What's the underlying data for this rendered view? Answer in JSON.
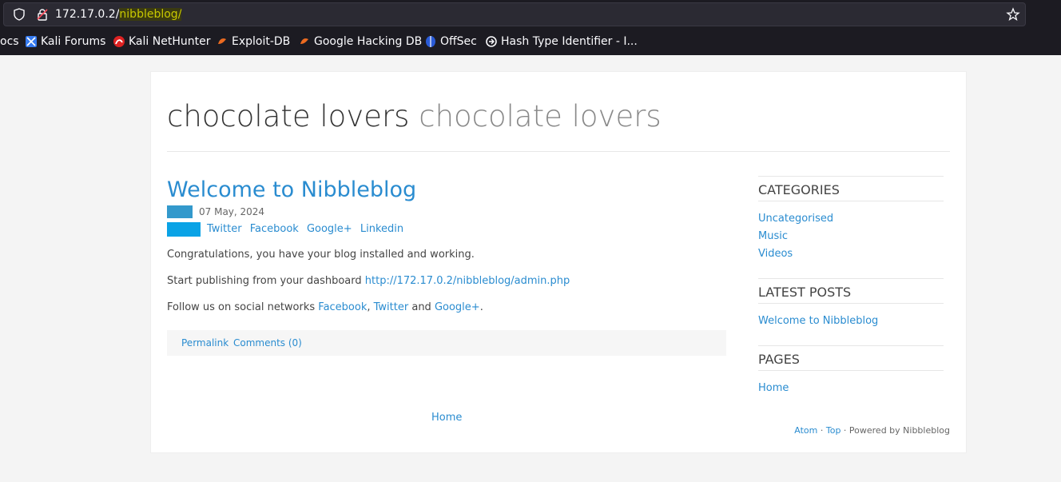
{
  "browser": {
    "url_host": "172.17.0.2/",
    "url_path": "nibbleblog/",
    "bookmarks": [
      {
        "label": "ocs",
        "icon": "none"
      },
      {
        "label": "Kali Forums",
        "icon": "kali-forums-icon"
      },
      {
        "label": "Kali NetHunter",
        "icon": "nethunter-icon"
      },
      {
        "label": "Exploit-DB",
        "icon": "exploit-db-icon"
      },
      {
        "label": "Google Hacking DB",
        "icon": "ghdb-icon"
      },
      {
        "label": "OffSec",
        "icon": "offsec-icon"
      },
      {
        "label": "Hash Type Identifier - I...",
        "icon": "hash-icon"
      }
    ]
  },
  "site": {
    "name": "chocolate lovers",
    "slogan": "chocolate lovers"
  },
  "post": {
    "title": "Welcome to Nibbleblog",
    "date": "07 May, 2024",
    "share": [
      "Twitter",
      "Facebook",
      "Google+",
      "Linkedin"
    ],
    "p1": "Congratulations, you have your blog installed and working.",
    "p2_text": "Start publishing from your dashboard ",
    "p2_link": "http://172.17.0.2/nibbleblog/admin.php",
    "p3_text": "Follow us on social networks ",
    "p3_link1": "Facebook",
    "p3_sep1": ", ",
    "p3_link2": "Twitter",
    "p3_sep2": " and ",
    "p3_link3": "Google+",
    "p3_end": ".",
    "permalink": "Permalink",
    "comments": "Comments (0)"
  },
  "pager": {
    "home": "Home"
  },
  "sidebar": {
    "categories_title": "CATEGORIES",
    "categories": [
      "Uncategorised",
      "Music",
      "Videos"
    ],
    "latest_title": "LATEST POSTS",
    "latest": [
      "Welcome to Nibbleblog"
    ],
    "pages_title": "PAGES",
    "pages": [
      "Home"
    ]
  },
  "footer": {
    "atom": "Atom",
    "sep1": " · ",
    "top": "Top",
    "powered": " · Powered by Nibbleblog"
  },
  "colors": {
    "link": "#2a8cd0",
    "chrome_bg": "#1c1b22"
  }
}
